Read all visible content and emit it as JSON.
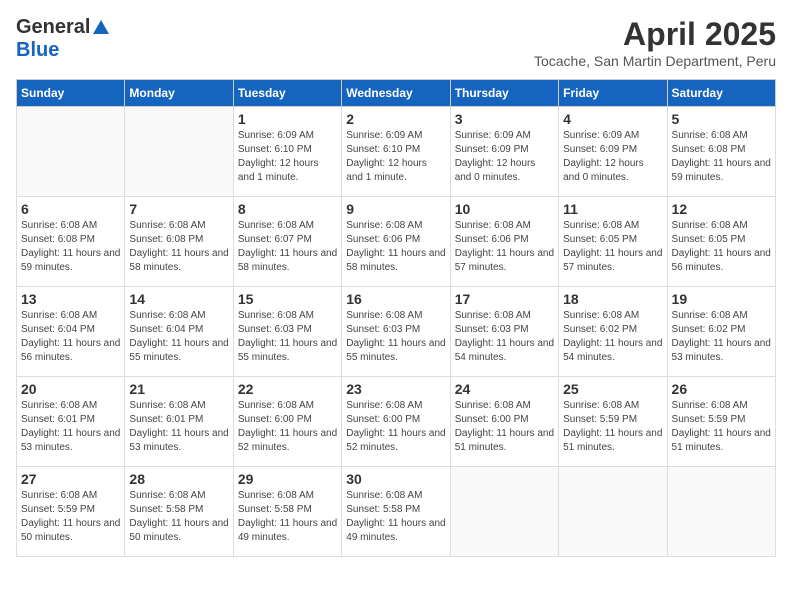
{
  "logo": {
    "general": "General",
    "blue": "Blue"
  },
  "title": "April 2025",
  "location": "Tocache, San Martin Department, Peru",
  "days_of_week": [
    "Sunday",
    "Monday",
    "Tuesday",
    "Wednesday",
    "Thursday",
    "Friday",
    "Saturday"
  ],
  "weeks": [
    [
      {
        "day": "",
        "info": ""
      },
      {
        "day": "",
        "info": ""
      },
      {
        "day": "1",
        "info": "Sunrise: 6:09 AM\nSunset: 6:10 PM\nDaylight: 12 hours and 1 minute."
      },
      {
        "day": "2",
        "info": "Sunrise: 6:09 AM\nSunset: 6:10 PM\nDaylight: 12 hours and 1 minute."
      },
      {
        "day": "3",
        "info": "Sunrise: 6:09 AM\nSunset: 6:09 PM\nDaylight: 12 hours and 0 minutes."
      },
      {
        "day": "4",
        "info": "Sunrise: 6:09 AM\nSunset: 6:09 PM\nDaylight: 12 hours and 0 minutes."
      },
      {
        "day": "5",
        "info": "Sunrise: 6:08 AM\nSunset: 6:08 PM\nDaylight: 11 hours and 59 minutes."
      }
    ],
    [
      {
        "day": "6",
        "info": "Sunrise: 6:08 AM\nSunset: 6:08 PM\nDaylight: 11 hours and 59 minutes."
      },
      {
        "day": "7",
        "info": "Sunrise: 6:08 AM\nSunset: 6:08 PM\nDaylight: 11 hours and 58 minutes."
      },
      {
        "day": "8",
        "info": "Sunrise: 6:08 AM\nSunset: 6:07 PM\nDaylight: 11 hours and 58 minutes."
      },
      {
        "day": "9",
        "info": "Sunrise: 6:08 AM\nSunset: 6:06 PM\nDaylight: 11 hours and 58 minutes."
      },
      {
        "day": "10",
        "info": "Sunrise: 6:08 AM\nSunset: 6:06 PM\nDaylight: 11 hours and 57 minutes."
      },
      {
        "day": "11",
        "info": "Sunrise: 6:08 AM\nSunset: 6:05 PM\nDaylight: 11 hours and 57 minutes."
      },
      {
        "day": "12",
        "info": "Sunrise: 6:08 AM\nSunset: 6:05 PM\nDaylight: 11 hours and 56 minutes."
      }
    ],
    [
      {
        "day": "13",
        "info": "Sunrise: 6:08 AM\nSunset: 6:04 PM\nDaylight: 11 hours and 56 minutes."
      },
      {
        "day": "14",
        "info": "Sunrise: 6:08 AM\nSunset: 6:04 PM\nDaylight: 11 hours and 55 minutes."
      },
      {
        "day": "15",
        "info": "Sunrise: 6:08 AM\nSunset: 6:03 PM\nDaylight: 11 hours and 55 minutes."
      },
      {
        "day": "16",
        "info": "Sunrise: 6:08 AM\nSunset: 6:03 PM\nDaylight: 11 hours and 55 minutes."
      },
      {
        "day": "17",
        "info": "Sunrise: 6:08 AM\nSunset: 6:03 PM\nDaylight: 11 hours and 54 minutes."
      },
      {
        "day": "18",
        "info": "Sunrise: 6:08 AM\nSunset: 6:02 PM\nDaylight: 11 hours and 54 minutes."
      },
      {
        "day": "19",
        "info": "Sunrise: 6:08 AM\nSunset: 6:02 PM\nDaylight: 11 hours and 53 minutes."
      }
    ],
    [
      {
        "day": "20",
        "info": "Sunrise: 6:08 AM\nSunset: 6:01 PM\nDaylight: 11 hours and 53 minutes."
      },
      {
        "day": "21",
        "info": "Sunrise: 6:08 AM\nSunset: 6:01 PM\nDaylight: 11 hours and 53 minutes."
      },
      {
        "day": "22",
        "info": "Sunrise: 6:08 AM\nSunset: 6:00 PM\nDaylight: 11 hours and 52 minutes."
      },
      {
        "day": "23",
        "info": "Sunrise: 6:08 AM\nSunset: 6:00 PM\nDaylight: 11 hours and 52 minutes."
      },
      {
        "day": "24",
        "info": "Sunrise: 6:08 AM\nSunset: 6:00 PM\nDaylight: 11 hours and 51 minutes."
      },
      {
        "day": "25",
        "info": "Sunrise: 6:08 AM\nSunset: 5:59 PM\nDaylight: 11 hours and 51 minutes."
      },
      {
        "day": "26",
        "info": "Sunrise: 6:08 AM\nSunset: 5:59 PM\nDaylight: 11 hours and 51 minutes."
      }
    ],
    [
      {
        "day": "27",
        "info": "Sunrise: 6:08 AM\nSunset: 5:59 PM\nDaylight: 11 hours and 50 minutes."
      },
      {
        "day": "28",
        "info": "Sunrise: 6:08 AM\nSunset: 5:58 PM\nDaylight: 11 hours and 50 minutes."
      },
      {
        "day": "29",
        "info": "Sunrise: 6:08 AM\nSunset: 5:58 PM\nDaylight: 11 hours and 49 minutes."
      },
      {
        "day": "30",
        "info": "Sunrise: 6:08 AM\nSunset: 5:58 PM\nDaylight: 11 hours and 49 minutes."
      },
      {
        "day": "",
        "info": ""
      },
      {
        "day": "",
        "info": ""
      },
      {
        "day": "",
        "info": ""
      }
    ]
  ]
}
